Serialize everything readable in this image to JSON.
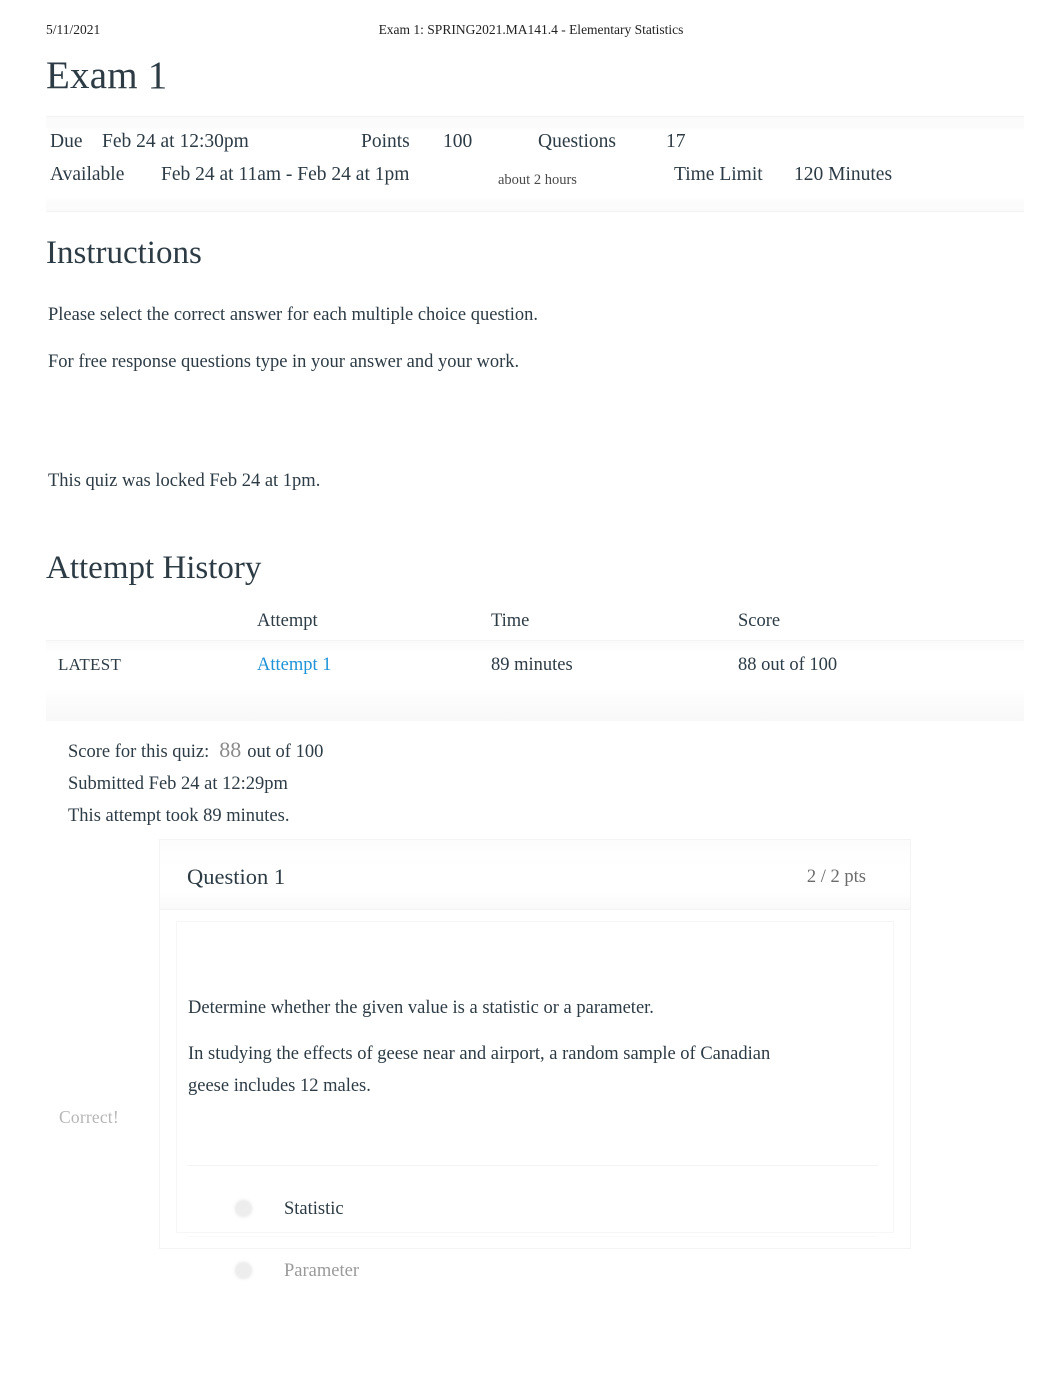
{
  "print_header": {
    "date": "5/11/2021",
    "title": "Exam 1: SPRING2021.MA141.4 - Elementary Statistics"
  },
  "page": {
    "title": "Exam 1"
  },
  "quiz_info": {
    "due_label": "Due",
    "due_value": "Feb 24 at 12:30pm",
    "points_label": "Points",
    "points_value": "100",
    "questions_label": "Questions",
    "questions_value": "17",
    "available_label": "Available",
    "available_value": "Feb 24 at 11am - Feb 24 at 1pm",
    "available_duration": "about 2 hours",
    "time_limit_label": "Time Limit",
    "time_limit_value": "120 Minutes"
  },
  "instructions": {
    "heading": "Instructions",
    "paragraph_1": "Please select the correct answer for each multiple choice question.",
    "paragraph_2": "For free response questions type in your answer and your work.",
    "locked_notice": "This quiz was locked Feb 24 at 1pm."
  },
  "attempt_history": {
    "heading": "Attempt History",
    "columns": [
      "",
      "Attempt",
      "Time",
      "Score"
    ],
    "rows": [
      {
        "kept": "LATEST",
        "attempt": "Attempt 1",
        "time": "89 minutes",
        "score": "88 out of 100"
      }
    ]
  },
  "score_summary": {
    "score_label": "Score for this quiz:",
    "score_value": "88",
    "score_out_of": "out of 100",
    "submitted": "Submitted Feb 24 at 12:29pm",
    "duration": "This attempt took 89 minutes."
  },
  "questions": [
    {
      "name": "Question 1",
      "points": "2 / 2 pts",
      "text_1": "Determine whether the given value is a statistic or a parameter.",
      "text_2": "In studying the effects of geese near and airport, a random sample of Canadian geese includes 12 males.",
      "correct_flag": "Correct!",
      "answers": [
        {
          "label": "Statistic",
          "state": "selected"
        },
        {
          "label": "Parameter",
          "state": "unselected"
        }
      ]
    }
  ],
  "colors": {
    "link": "#1f93d6",
    "text": "#2d3b45",
    "muted": "#9a9a9a",
    "faint": "#b6b6b6"
  }
}
